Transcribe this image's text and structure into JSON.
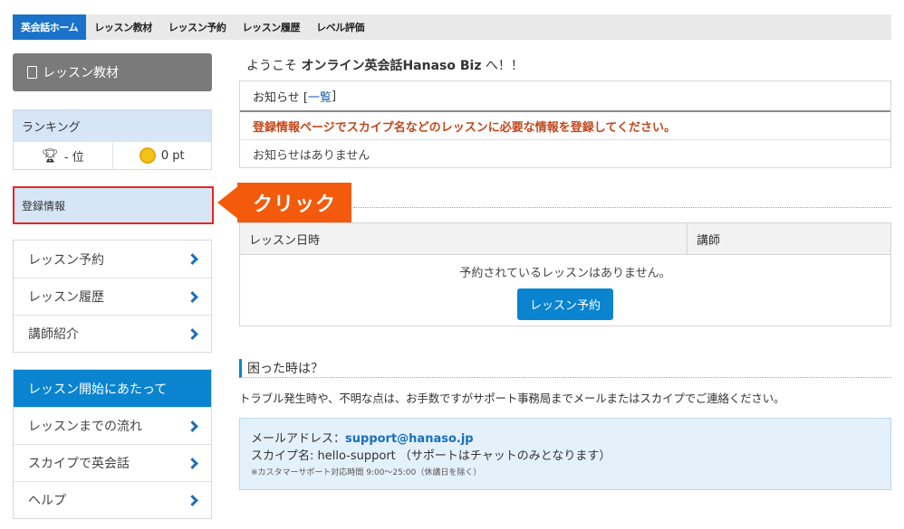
{
  "topnav": {
    "tabs": [
      "英会話ホーム",
      "レッスン教材",
      "レッスン予約",
      "レッスン履歴",
      "レベル評価"
    ]
  },
  "sidebar": {
    "materials_button": "レッスン教材",
    "ranking": {
      "title": "ランキング",
      "rank": "- 位",
      "points": "0 pt"
    },
    "registration": "登録情報",
    "menu1": [
      "レッスン予約",
      "レッスン履歴",
      "講師紹介"
    ],
    "start_section": {
      "title": "レッスン開始にあたって",
      "items": [
        "レッスンまでの流れ",
        "スカイプで英会話",
        "ヘルプ"
      ]
    }
  },
  "callout": {
    "text": "クリック"
  },
  "main": {
    "welcome_prefix": "ようこそ ",
    "welcome_name": "オンライン英会話Hanaso Biz",
    "welcome_suffix": " へ！！",
    "notice": {
      "title": "お知らせ [",
      "link": "一覧",
      "title_end": "]",
      "warning": "登録情報ページでスカイプ名などのレッスンに必要な情報を登録してください。",
      "empty": "お知らせはありません"
    },
    "schedule": {
      "col_datetime": "レッスン日時",
      "col_teacher": "講師",
      "empty": "予約されているレッスンはありません。",
      "button": "レッスン予約"
    },
    "trouble": {
      "title": "困った時は？",
      "text": "トラブル発生時や、不明な点は、お手数ですがサポート事務局までメールまたはスカイプでご連絡ください。",
      "email_label": "メールアドレス：",
      "email": "support@hanaso.jp",
      "skype": "スカイプ名: hello-support （サポートはチャットのみとなります）",
      "hours": "※カスタマーサポート対応時間 9:00～25:00（休講日を除く）"
    }
  },
  "colors": {
    "accent": "#0a84cf",
    "nav_active": "#1a73c8",
    "highlight": "#e8261f",
    "callout": "#f45a0c"
  },
  "icons": [
    "document-icon",
    "trophy-icon",
    "coin-icon",
    "chevron-right-icon"
  ]
}
